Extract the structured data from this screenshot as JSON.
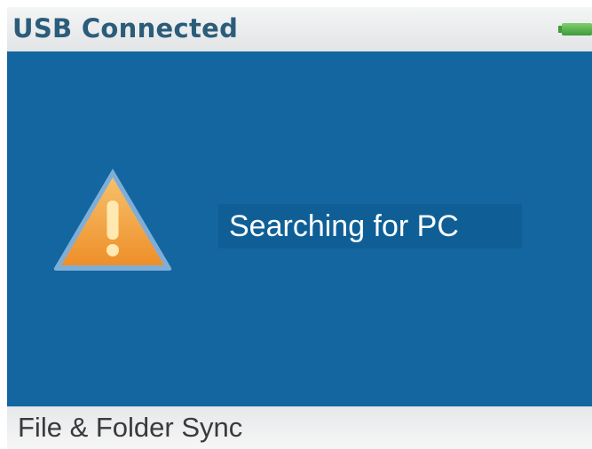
{
  "header": {
    "title": "USB Connected",
    "battery_icon": "battery-full-icon",
    "battery_level": 1.0
  },
  "main": {
    "icon": "warning-icon",
    "status": "Searching for PC"
  },
  "footer": {
    "label": "File & Folder Sync"
  },
  "colors": {
    "main_background": "#1366a0",
    "header_text": "#2b5d7a",
    "warning_fill": "#f2a23a",
    "battery": "#4caf50"
  }
}
